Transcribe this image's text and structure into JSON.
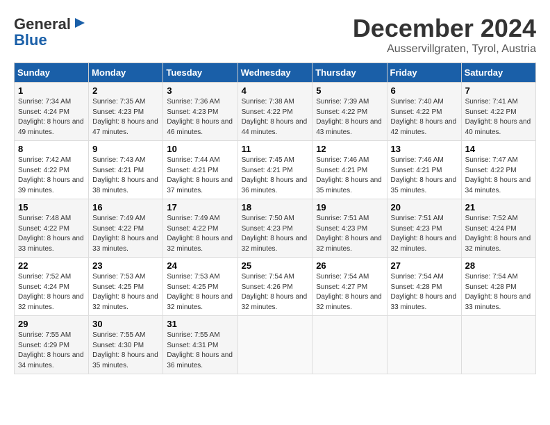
{
  "header": {
    "logo_line1": "General",
    "logo_line2": "Blue",
    "month": "December 2024",
    "location": "Ausservillgraten, Tyrol, Austria"
  },
  "days_of_week": [
    "Sunday",
    "Monday",
    "Tuesday",
    "Wednesday",
    "Thursday",
    "Friday",
    "Saturday"
  ],
  "weeks": [
    [
      {
        "day": "1",
        "sunrise": "Sunrise: 7:34 AM",
        "sunset": "Sunset: 4:24 PM",
        "daylight": "Daylight: 8 hours and 49 minutes."
      },
      {
        "day": "2",
        "sunrise": "Sunrise: 7:35 AM",
        "sunset": "Sunset: 4:23 PM",
        "daylight": "Daylight: 8 hours and 47 minutes."
      },
      {
        "day": "3",
        "sunrise": "Sunrise: 7:36 AM",
        "sunset": "Sunset: 4:23 PM",
        "daylight": "Daylight: 8 hours and 46 minutes."
      },
      {
        "day": "4",
        "sunrise": "Sunrise: 7:38 AM",
        "sunset": "Sunset: 4:22 PM",
        "daylight": "Daylight: 8 hours and 44 minutes."
      },
      {
        "day": "5",
        "sunrise": "Sunrise: 7:39 AM",
        "sunset": "Sunset: 4:22 PM",
        "daylight": "Daylight: 8 hours and 43 minutes."
      },
      {
        "day": "6",
        "sunrise": "Sunrise: 7:40 AM",
        "sunset": "Sunset: 4:22 PM",
        "daylight": "Daylight: 8 hours and 42 minutes."
      },
      {
        "day": "7",
        "sunrise": "Sunrise: 7:41 AM",
        "sunset": "Sunset: 4:22 PM",
        "daylight": "Daylight: 8 hours and 40 minutes."
      }
    ],
    [
      {
        "day": "8",
        "sunrise": "Sunrise: 7:42 AM",
        "sunset": "Sunset: 4:22 PM",
        "daylight": "Daylight: 8 hours and 39 minutes."
      },
      {
        "day": "9",
        "sunrise": "Sunrise: 7:43 AM",
        "sunset": "Sunset: 4:21 PM",
        "daylight": "Daylight: 8 hours and 38 minutes."
      },
      {
        "day": "10",
        "sunrise": "Sunrise: 7:44 AM",
        "sunset": "Sunset: 4:21 PM",
        "daylight": "Daylight: 8 hours and 37 minutes."
      },
      {
        "day": "11",
        "sunrise": "Sunrise: 7:45 AM",
        "sunset": "Sunset: 4:21 PM",
        "daylight": "Daylight: 8 hours and 36 minutes."
      },
      {
        "day": "12",
        "sunrise": "Sunrise: 7:46 AM",
        "sunset": "Sunset: 4:21 PM",
        "daylight": "Daylight: 8 hours and 35 minutes."
      },
      {
        "day": "13",
        "sunrise": "Sunrise: 7:46 AM",
        "sunset": "Sunset: 4:21 PM",
        "daylight": "Daylight: 8 hours and 35 minutes."
      },
      {
        "day": "14",
        "sunrise": "Sunrise: 7:47 AM",
        "sunset": "Sunset: 4:22 PM",
        "daylight": "Daylight: 8 hours and 34 minutes."
      }
    ],
    [
      {
        "day": "15",
        "sunrise": "Sunrise: 7:48 AM",
        "sunset": "Sunset: 4:22 PM",
        "daylight": "Daylight: 8 hours and 33 minutes."
      },
      {
        "day": "16",
        "sunrise": "Sunrise: 7:49 AM",
        "sunset": "Sunset: 4:22 PM",
        "daylight": "Daylight: 8 hours and 33 minutes."
      },
      {
        "day": "17",
        "sunrise": "Sunrise: 7:49 AM",
        "sunset": "Sunset: 4:22 PM",
        "daylight": "Daylight: 8 hours and 32 minutes."
      },
      {
        "day": "18",
        "sunrise": "Sunrise: 7:50 AM",
        "sunset": "Sunset: 4:23 PM",
        "daylight": "Daylight: 8 hours and 32 minutes."
      },
      {
        "day": "19",
        "sunrise": "Sunrise: 7:51 AM",
        "sunset": "Sunset: 4:23 PM",
        "daylight": "Daylight: 8 hours and 32 minutes."
      },
      {
        "day": "20",
        "sunrise": "Sunrise: 7:51 AM",
        "sunset": "Sunset: 4:23 PM",
        "daylight": "Daylight: 8 hours and 32 minutes."
      },
      {
        "day": "21",
        "sunrise": "Sunrise: 7:52 AM",
        "sunset": "Sunset: 4:24 PM",
        "daylight": "Daylight: 8 hours and 32 minutes."
      }
    ],
    [
      {
        "day": "22",
        "sunrise": "Sunrise: 7:52 AM",
        "sunset": "Sunset: 4:24 PM",
        "daylight": "Daylight: 8 hours and 32 minutes."
      },
      {
        "day": "23",
        "sunrise": "Sunrise: 7:53 AM",
        "sunset": "Sunset: 4:25 PM",
        "daylight": "Daylight: 8 hours and 32 minutes."
      },
      {
        "day": "24",
        "sunrise": "Sunrise: 7:53 AM",
        "sunset": "Sunset: 4:25 PM",
        "daylight": "Daylight: 8 hours and 32 minutes."
      },
      {
        "day": "25",
        "sunrise": "Sunrise: 7:54 AM",
        "sunset": "Sunset: 4:26 PM",
        "daylight": "Daylight: 8 hours and 32 minutes."
      },
      {
        "day": "26",
        "sunrise": "Sunrise: 7:54 AM",
        "sunset": "Sunset: 4:27 PM",
        "daylight": "Daylight: 8 hours and 32 minutes."
      },
      {
        "day": "27",
        "sunrise": "Sunrise: 7:54 AM",
        "sunset": "Sunset: 4:28 PM",
        "daylight": "Daylight: 8 hours and 33 minutes."
      },
      {
        "day": "28",
        "sunrise": "Sunrise: 7:54 AM",
        "sunset": "Sunset: 4:28 PM",
        "daylight": "Daylight: 8 hours and 33 minutes."
      }
    ],
    [
      {
        "day": "29",
        "sunrise": "Sunrise: 7:55 AM",
        "sunset": "Sunset: 4:29 PM",
        "daylight": "Daylight: 8 hours and 34 minutes."
      },
      {
        "day": "30",
        "sunrise": "Sunrise: 7:55 AM",
        "sunset": "Sunset: 4:30 PM",
        "daylight": "Daylight: 8 hours and 35 minutes."
      },
      {
        "day": "31",
        "sunrise": "Sunrise: 7:55 AM",
        "sunset": "Sunset: 4:31 PM",
        "daylight": "Daylight: 8 hours and 36 minutes."
      },
      null,
      null,
      null,
      null
    ]
  ]
}
